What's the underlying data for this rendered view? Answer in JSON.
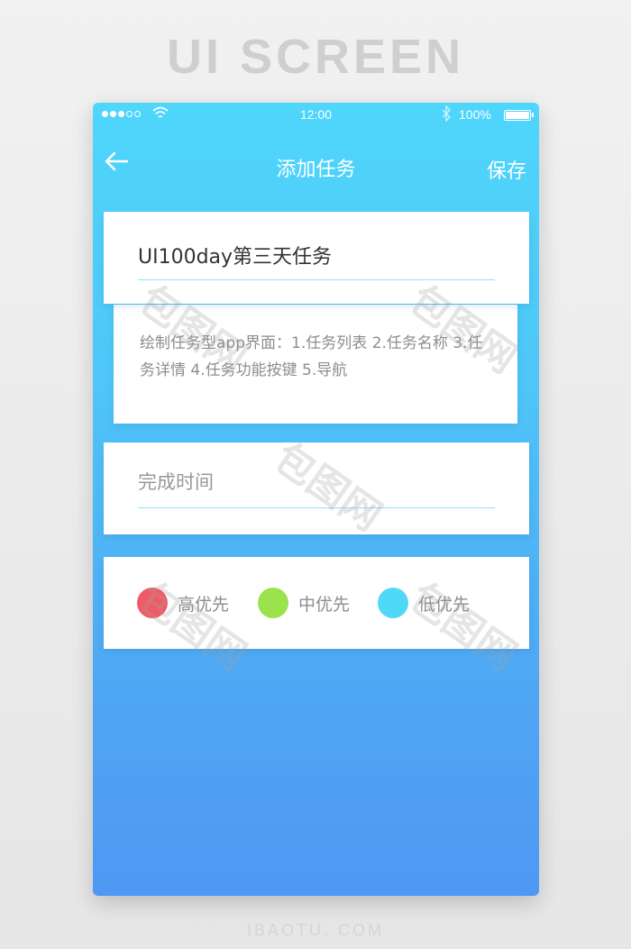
{
  "page": {
    "headline": "UI SCREEN",
    "footer": "IBAOTU. COM"
  },
  "status_bar": {
    "time": "12:00",
    "battery": "100%",
    "signal_icon": "signal-dots-icon",
    "wifi_icon": "wifi-icon",
    "bluetooth_icon": "bluetooth-icon"
  },
  "nav": {
    "back_icon": "arrow-left-icon",
    "title": "添加任务",
    "save_label": "保存"
  },
  "task": {
    "title": "UI100day第三天任务",
    "description": "绘制任务型app界面：1.任务列表 2.任务名称 3.任务详情 4.任务功能按键 5.导航",
    "due_placeholder": "完成时间"
  },
  "priority": [
    {
      "label": "高优先",
      "color": "#f05a64"
    },
    {
      "label": "中优先",
      "color": "#9ae34c"
    },
    {
      "label": "低优先",
      "color": "#4fd9f7"
    }
  ],
  "watermark": "包图网",
  "colors": {
    "accent": "#4fc6f8",
    "underline": "#8ee4f7"
  }
}
